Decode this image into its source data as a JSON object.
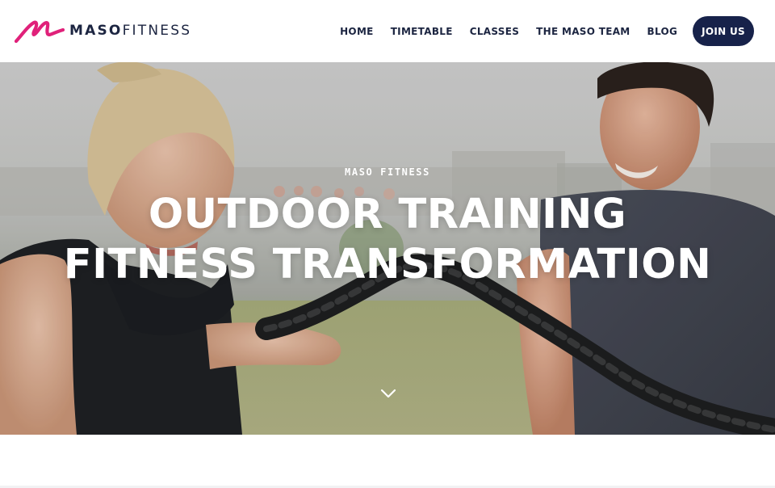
{
  "brand": {
    "name_bold": "MASO",
    "name_light": "FITNESS",
    "accent_color": "#e0217a",
    "navy_color": "#17224a"
  },
  "nav": {
    "items": [
      {
        "label": "HOME"
      },
      {
        "label": "TIMETABLE"
      },
      {
        "label": "CLASSES"
      },
      {
        "label": "THE MASO TEAM"
      },
      {
        "label": "BLOG"
      }
    ],
    "cta_label": "JOIN US"
  },
  "hero": {
    "eyebrow": "MASO FITNESS",
    "title_line1": "OUTDOOR TRAINING",
    "title_line2": "FITNESS TRANSFORMATION",
    "scroll_icon": "chevron-down-icon"
  }
}
